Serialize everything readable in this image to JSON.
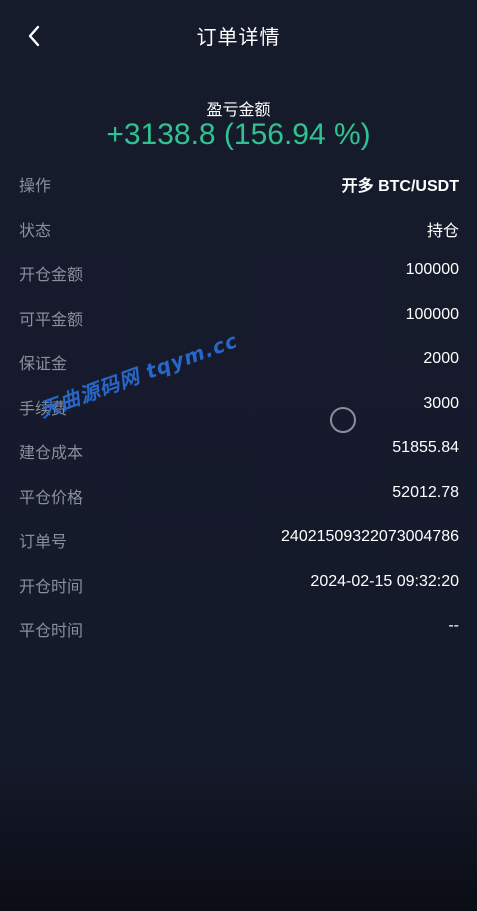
{
  "header": {
    "title": "订单详情"
  },
  "pnl": {
    "label": "盈亏金额",
    "value": "+3138.8 (156.94 %)"
  },
  "rows": [
    {
      "label": "操作",
      "value": "开多 BTC/USDT"
    },
    {
      "label": "状态",
      "value": "持仓"
    },
    {
      "label": "开仓金额",
      "value": "100000"
    },
    {
      "label": "可平金额",
      "value": "100000"
    },
    {
      "label": "保证金",
      "value": "2000"
    },
    {
      "label": "手续费",
      "value": "3000"
    },
    {
      "label": "建仓成本",
      "value": "51855.84"
    },
    {
      "label": "平仓价格",
      "value": "52012.78"
    },
    {
      "label": "订单号",
      "value": "24021509322073004786"
    },
    {
      "label": "开仓时间",
      "value": "2024-02-15 09:32:20"
    },
    {
      "label": "平仓时间",
      "value": "--"
    }
  ],
  "watermark": "天曲源码网 tqym.cc",
  "colors": {
    "background": "#161b2c",
    "profit": "#30c28f",
    "label": "#8a8f9e",
    "watermark": "#2a6fd8"
  },
  "icons": {
    "back": "chevron-left-icon",
    "loading": "loading-spinner-icon"
  }
}
